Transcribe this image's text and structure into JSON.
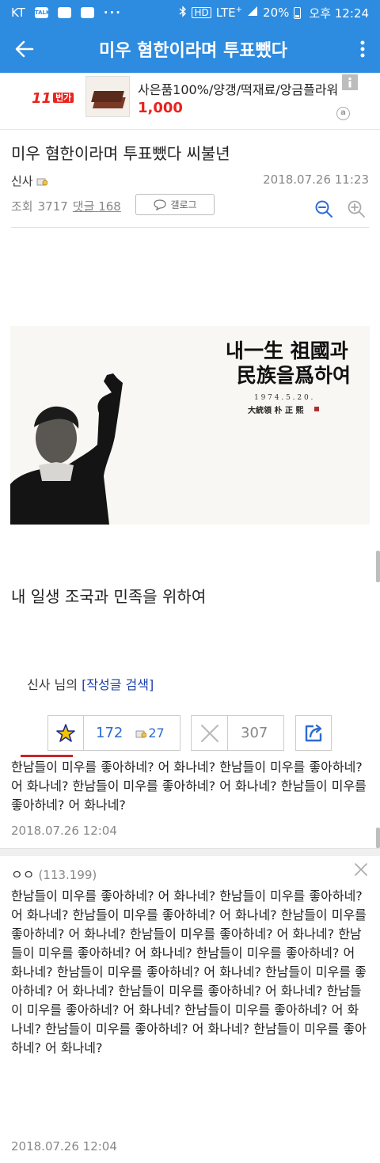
{
  "status_bar": {
    "carrier": "KT",
    "talk_chip": "TALK",
    "dots": "···",
    "network": "LTE",
    "lte_plus": "+",
    "battery": "20%",
    "time": "오후 12:24"
  },
  "app_bar": {
    "title": "미우 혐한이라며 투표뺐다"
  },
  "ad": {
    "logo": "11",
    "logo_suffix": "번가",
    "title": "사은품100%/양갱/떡재료/앙금플라워",
    "price": "1,000",
    "badge": "a"
  },
  "post": {
    "title": "미우 혐한이라며 투표뺐다 씨불년",
    "author": "신사",
    "date": "2018.07.26 11:23",
    "views_label": "조회",
    "views": "3717",
    "comments_label": "댓글",
    "comments": "168",
    "gallog_label": "갤로그",
    "body": "내 일생 조국과 민족을 위하여",
    "image_text": {
      "line1": "내一生 祖國과",
      "line2": "民族을爲하여",
      "date": "1 9 7 4 . 5 . 2 0 .",
      "sign": "大統領 朴 正 熙"
    }
  },
  "author_search": {
    "prefix": "신사 님의",
    "link": "[작성글 검색]"
  },
  "votes": {
    "up": "172",
    "fixed": "27",
    "down": "307"
  },
  "comments": [
    {
      "text": "한남들이 미우를 좋아하네? 어 화나네? 한남들이 미우를 좋아하네? 어 화나네? 한남들이 미우를 좋아하네? 어 화나네? 한남들이 미우를 좋아하네? 어 화나네?",
      "date": "2018.07.26 12:04"
    },
    {
      "author": "ㅇㅇ",
      "ip": "(113.199)",
      "text": "한남들이 미우를 좋아하네? 어 화나네? 한남들이 미우를 좋아하네? 어 화나네? 한남들이 미우를 좋아하네? 어 화나네? 한남들이 미우를 좋아하네? 어 화나네? 한남들이 미우를 좋아하네? 어 화나네? 한남들이 미우를 좋아하네? 어 화나네? 한남들이 미우를 좋아하네? 어 화나네? 한남들이 미우를 좋아하네? 어 화나네? 한남들이 미우를 좋아하네? 어 화나네? 한남들이 미우를 좋아하네? 어 화나네? 한남들이 미우를 좋아하네? 어 화나네? 한남들이 미우를 좋아하네? 어 화나네? 한남들이 미우를 좋아하네? 어 화나네? 한남들이 미우를 좋아하네? 어 화나네?",
      "date": "2018.07.26 12:04"
    }
  ],
  "colors": {
    "brand_blue": "#2d8be0",
    "accent_red": "#c8252c",
    "link_blue": "#1a3fa8"
  }
}
